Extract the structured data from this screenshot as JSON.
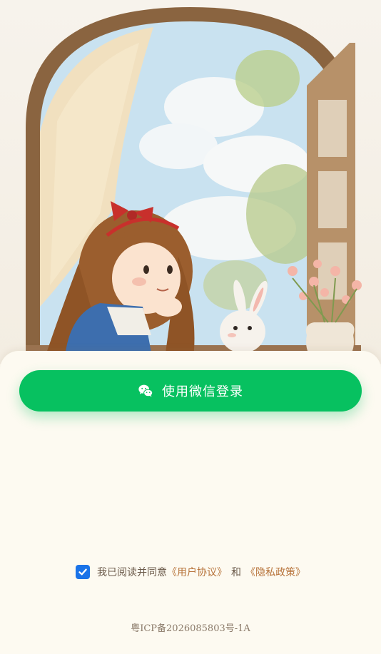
{
  "login": {
    "wechat_button_label": "使用微信登录"
  },
  "agreement": {
    "checked": true,
    "prefix": "我已阅读并同意",
    "user_agreement": "《用户协议》",
    "conjunction": "和",
    "privacy_policy": "《隐私政策》"
  },
  "footer": {
    "icp": "粤ICP备2026085803号-1A"
  },
  "icons": {
    "wechat": "wechat-icon",
    "checkbox": "checkmark-icon"
  },
  "colors": {
    "brand_green": "#07c160",
    "checkbox_blue": "#1a73e8",
    "link": "#b7733a"
  }
}
